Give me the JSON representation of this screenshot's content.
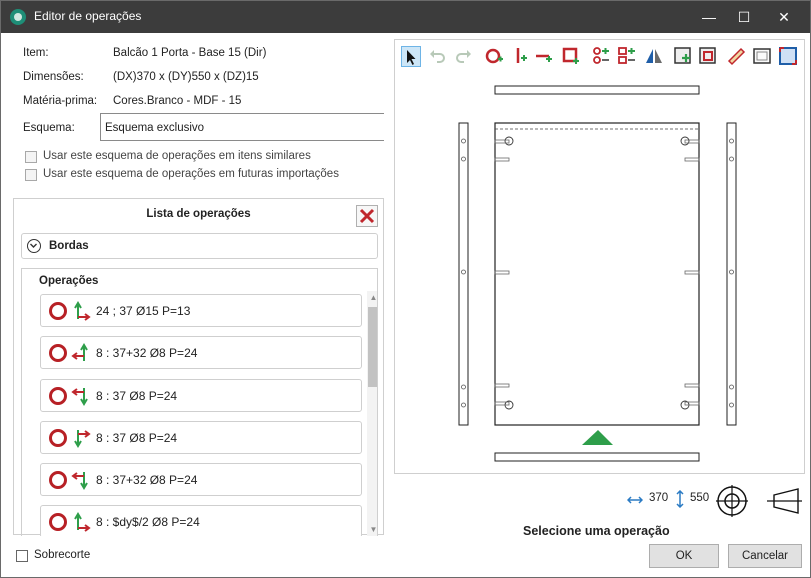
{
  "window": {
    "title": "Editor de operações",
    "controls": {
      "minimize": "—",
      "maximize": "☐",
      "close": "✕"
    }
  },
  "properties": {
    "item_label": "Item:",
    "item_value": "Balcão 1 Porta - Base 15 (Dir)",
    "dim_label": "Dimensões:",
    "dim_value": "(DX)370 x (DY)550 x (DZ)15",
    "mat_label": "Matéria-prima:",
    "mat_value": "Cores.Branco - MDF - 15",
    "esq_label": "Esquema:",
    "esq_value": "Esquema exclusivo"
  },
  "checkboxes": {
    "similar": "Usar este esquema de operações em itens similares",
    "futuras": "Usar este esquema de operações em futuras importações"
  },
  "operations_panel": {
    "title": "Lista de operações",
    "bordas_label": "Bordas",
    "operacoes_label": "Operações",
    "items": [
      {
        "text": "24 ; 37 Ø15 P=13"
      },
      {
        "text": "8 : 37+32 Ø8 P=24"
      },
      {
        "text": "8 : 37 Ø8 P=24"
      },
      {
        "text": "8 : 37 Ø8 P=24"
      },
      {
        "text": "8 : 37+32 Ø8 P=24"
      },
      {
        "text": "8 : $dy$/2 Ø8 P=24"
      }
    ]
  },
  "sobrecorte_label": "Sobrecorte",
  "dimensions": {
    "width": "370",
    "height": "550"
  },
  "status_text": "Selecione uma operação",
  "buttons": {
    "ok": "OK",
    "cancel": "Cancelar"
  },
  "colors": {
    "accent_red": "#b72025",
    "green": "#2e9e4a",
    "titlebar": "#3c3c3c"
  }
}
